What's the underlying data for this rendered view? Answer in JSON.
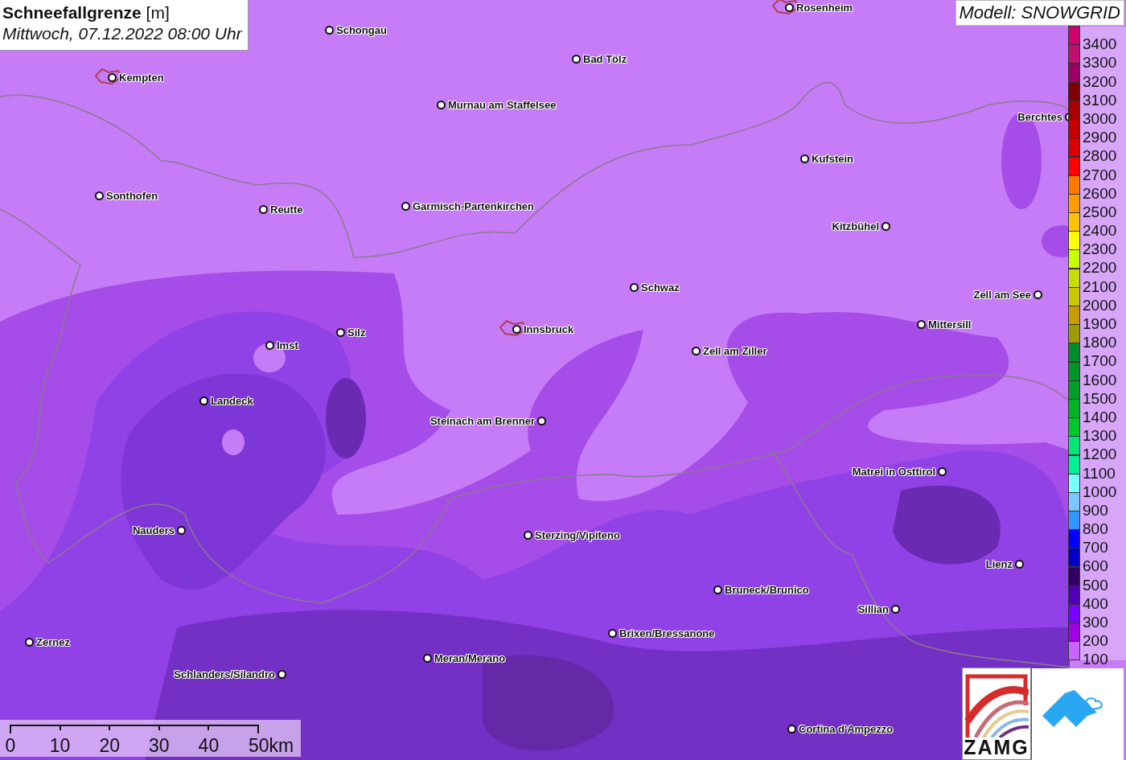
{
  "title": {
    "heading": "**Schneefallgrenze** [m]",
    "subtitle": "Mittwoch, 07.12.2022 08:00 Uhr"
  },
  "model": "Modell: SNOWGRID",
  "towns": [
    {
      "name": "Rosenheim",
      "outline": true
    },
    {
      "name": "Schongau",
      "outline": false
    },
    {
      "name": "Bad Tölz",
      "outline": false
    },
    {
      "name": "Kempten",
      "outline": true
    },
    {
      "name": "Murnau am Staffelsee",
      "outline": false
    },
    {
      "name": "Berchtes",
      "outline": false
    },
    {
      "name": "Kufstein",
      "outline": false
    },
    {
      "name": "Sonthofen",
      "outline": false
    },
    {
      "name": "Reutte",
      "outline": false
    },
    {
      "name": "Garmisch-Partenkirchen",
      "outline": false
    },
    {
      "name": "Kitzbühel",
      "outline": false
    },
    {
      "name": "Schwaz",
      "outline": false
    },
    {
      "name": "Zell am See",
      "outline": false
    },
    {
      "name": "Mittersill",
      "outline": false
    },
    {
      "name": "Innsbruck",
      "outline": true
    },
    {
      "name": "Silz",
      "outline": false
    },
    {
      "name": "Imst",
      "outline": false
    },
    {
      "name": "Zell am Ziller",
      "outline": false
    },
    {
      "name": "Landeck",
      "outline": false
    },
    {
      "name": "Steinach am Brenner",
      "outline": false
    },
    {
      "name": "Matrei in Osttirol",
      "outline": false
    },
    {
      "name": "Nauders",
      "outline": false
    },
    {
      "name": "Sterzing/Vipiteno",
      "outline": false
    },
    {
      "name": "Lienz",
      "outline": false
    },
    {
      "name": "Bruneck/Brunico",
      "outline": false
    },
    {
      "name": "Sillian",
      "outline": false
    },
    {
      "name": "Brixen/Bressanone",
      "outline": false
    },
    {
      "name": "Zernez",
      "outline": false
    },
    {
      "name": "Meran/Merano",
      "outline": false
    },
    {
      "name": "Schlanders/Silandro",
      "outline": false
    },
    {
      "name": "Cortina d'Ampezzo",
      "outline": false
    }
  ],
  "legend": [
    {
      "label": "3400",
      "color": "#d0006e"
    },
    {
      "label": "3300",
      "color": "#c0106e"
    },
    {
      "label": "3200",
      "color": "#9c0064"
    },
    {
      "label": "3100",
      "color": "#800000"
    },
    {
      "label": "3000",
      "color": "#a80000"
    },
    {
      "label": "2900",
      "color": "#c40000"
    },
    {
      "label": "2800",
      "color": "#dc0000"
    },
    {
      "label": "2700",
      "color": "#ff0000"
    },
    {
      "label": "2600",
      "color": "#ff7800"
    },
    {
      "label": "2500",
      "color": "#ff9c00"
    },
    {
      "label": "2400",
      "color": "#ffc400"
    },
    {
      "label": "2300",
      "color": "#ffff00"
    },
    {
      "label": "2200",
      "color": "#c8ff00"
    },
    {
      "label": "2100",
      "color": "#c8dc00"
    },
    {
      "label": "2000",
      "color": "#c8c800"
    },
    {
      "label": "1900",
      "color": "#c89c00"
    },
    {
      "label": "1800",
      "color": "#9c9c00"
    },
    {
      "label": "1700",
      "color": "#008c28"
    },
    {
      "label": "1600",
      "color": "#009628"
    },
    {
      "label": "1500",
      "color": "#00a028"
    },
    {
      "label": "1400",
      "color": "#00b428"
    },
    {
      "label": "1300",
      "color": "#00c828"
    },
    {
      "label": "1200",
      "color": "#00e678"
    },
    {
      "label": "1100",
      "color": "#00f096"
    },
    {
      "label": "1000",
      "color": "#78ffff"
    },
    {
      "label": "900",
      "color": "#78c8ff"
    },
    {
      "label": "800",
      "color": "#3296ff"
    },
    {
      "label": "700",
      "color": "#0000ff"
    },
    {
      "label": "600",
      "color": "#0000c8"
    },
    {
      "label": "500",
      "color": "#320064"
    },
    {
      "label": "400",
      "color": "#5000b4"
    },
    {
      "label": "300",
      "color": "#7800ff"
    },
    {
      "label": "200",
      "color": "#a000e6"
    },
    {
      "label": "100",
      "color": "#c864ff"
    }
  ],
  "scale": [
    "0",
    "10",
    "20",
    "30",
    "40",
    "50km"
  ],
  "logo": "ZAMG"
}
